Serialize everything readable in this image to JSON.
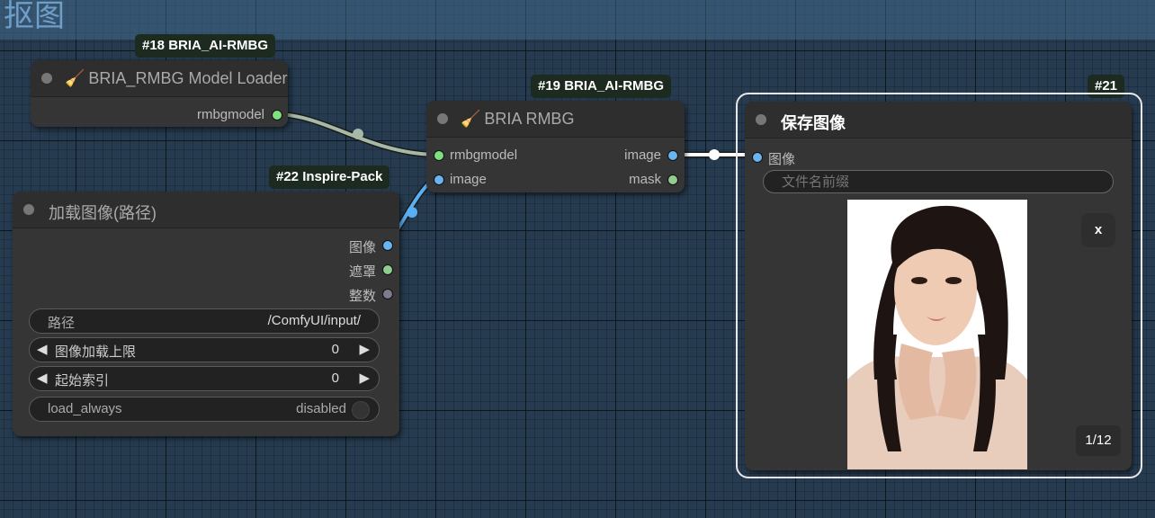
{
  "group": {
    "title": "抠图"
  },
  "nodes": {
    "model_loader": {
      "badge": "#18 BRIA_AI-RMBG",
      "title": "BRIA_RMBG Model Loader",
      "outputs": [
        "rmbgmodel"
      ]
    },
    "rmbg": {
      "badge": "#19 BRIA_AI-RMBG",
      "title": "BRIA RMBG",
      "inputs": [
        "rmbgmodel",
        "image"
      ],
      "outputs": [
        "image",
        "mask"
      ]
    },
    "load_image": {
      "badge": "#22 Inspire-Pack",
      "title": "加载图像(路径)",
      "outputs": [
        "图像",
        "遮罩",
        "整数"
      ],
      "widgets": {
        "path": {
          "label": "路径",
          "value": "/ComfyUI/input/"
        },
        "image_load_cap": {
          "label": "图像加载上限",
          "value": "0"
        },
        "start_index": {
          "label": "起始索引",
          "value": "0"
        },
        "load_always": {
          "label": "load_always",
          "value": "disabled"
        }
      }
    },
    "save_image": {
      "badge": "#21",
      "title": "保存图像",
      "inputs": [
        "图像"
      ],
      "filename_prefix_placeholder": "文件名前缀",
      "close_label": "x",
      "counter": "1/12"
    }
  },
  "icons": {
    "node_icon": "broom-icon",
    "collapse": "circle-dot-icon",
    "arrow_left": "◀",
    "arrow_right": "▶"
  },
  "colors": {
    "model_socket": "#7ee07e",
    "image_socket": "#6ab4ef",
    "mask_socket": "#8fce8f",
    "int_socket": "#7c7c8c",
    "selected_outline": "#ffffff",
    "badge_bg": "#1c2a1f"
  }
}
